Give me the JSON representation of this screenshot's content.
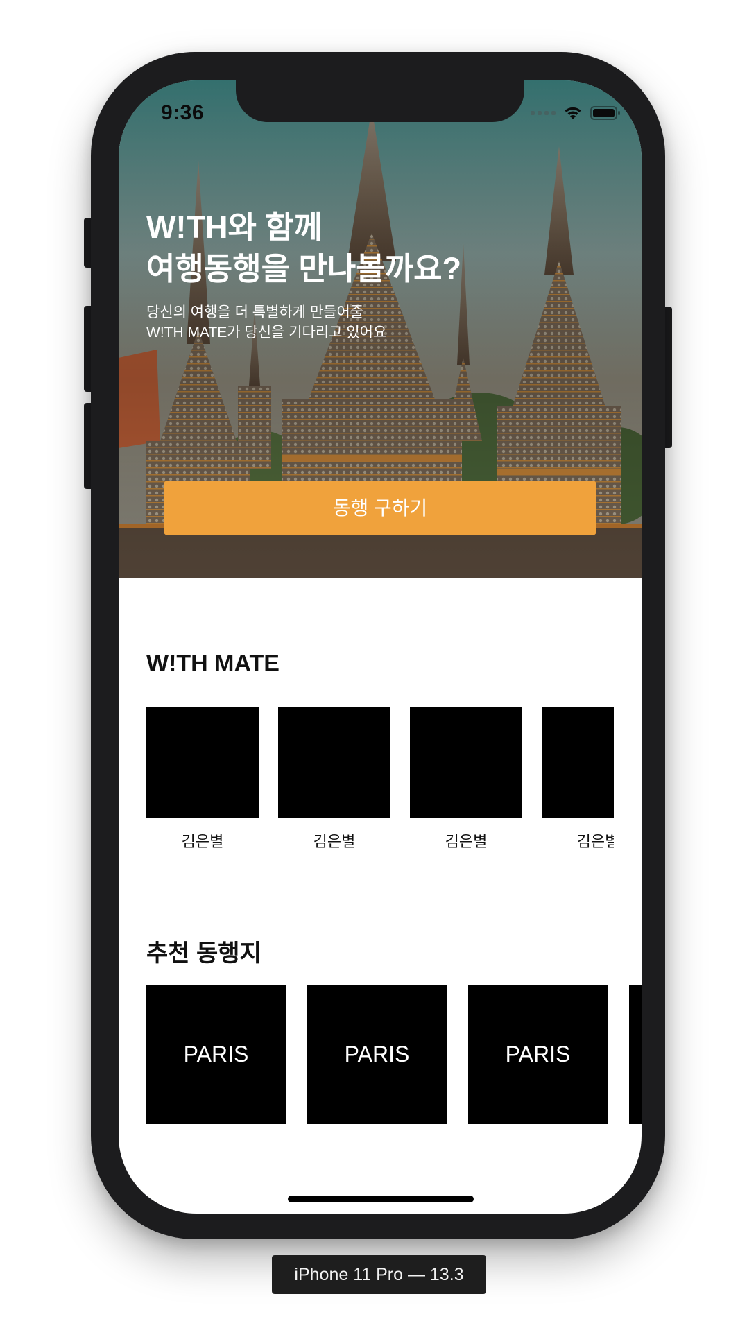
{
  "status_bar": {
    "time": "9:36",
    "icons": [
      "cellular-signal-icon",
      "wifi-icon",
      "battery-icon"
    ]
  },
  "hero": {
    "title_lines": [
      "W!TH와 함께",
      "여행동행을 만나볼까요?"
    ],
    "subtitle_lines": [
      "당신의 여행을 더 특별하게 만들어줄",
      "W!TH MATE가 당신을 기다리고 있어요"
    ],
    "cta_label": "동행 구하기",
    "cta_color": "#f0a23c"
  },
  "mate_section": {
    "title": "W!TH MATE",
    "mates": [
      {
        "name": "김은별"
      },
      {
        "name": "김은별"
      },
      {
        "name": "김은별"
      },
      {
        "name": "김은별"
      }
    ]
  },
  "destination_section": {
    "title": "추천 동행지",
    "destinations": [
      {
        "name": "PARIS"
      },
      {
        "name": "PARIS"
      },
      {
        "name": "PARIS"
      },
      {
        "name": ""
      }
    ]
  },
  "simulator_label": "iPhone 11 Pro — 13.3"
}
